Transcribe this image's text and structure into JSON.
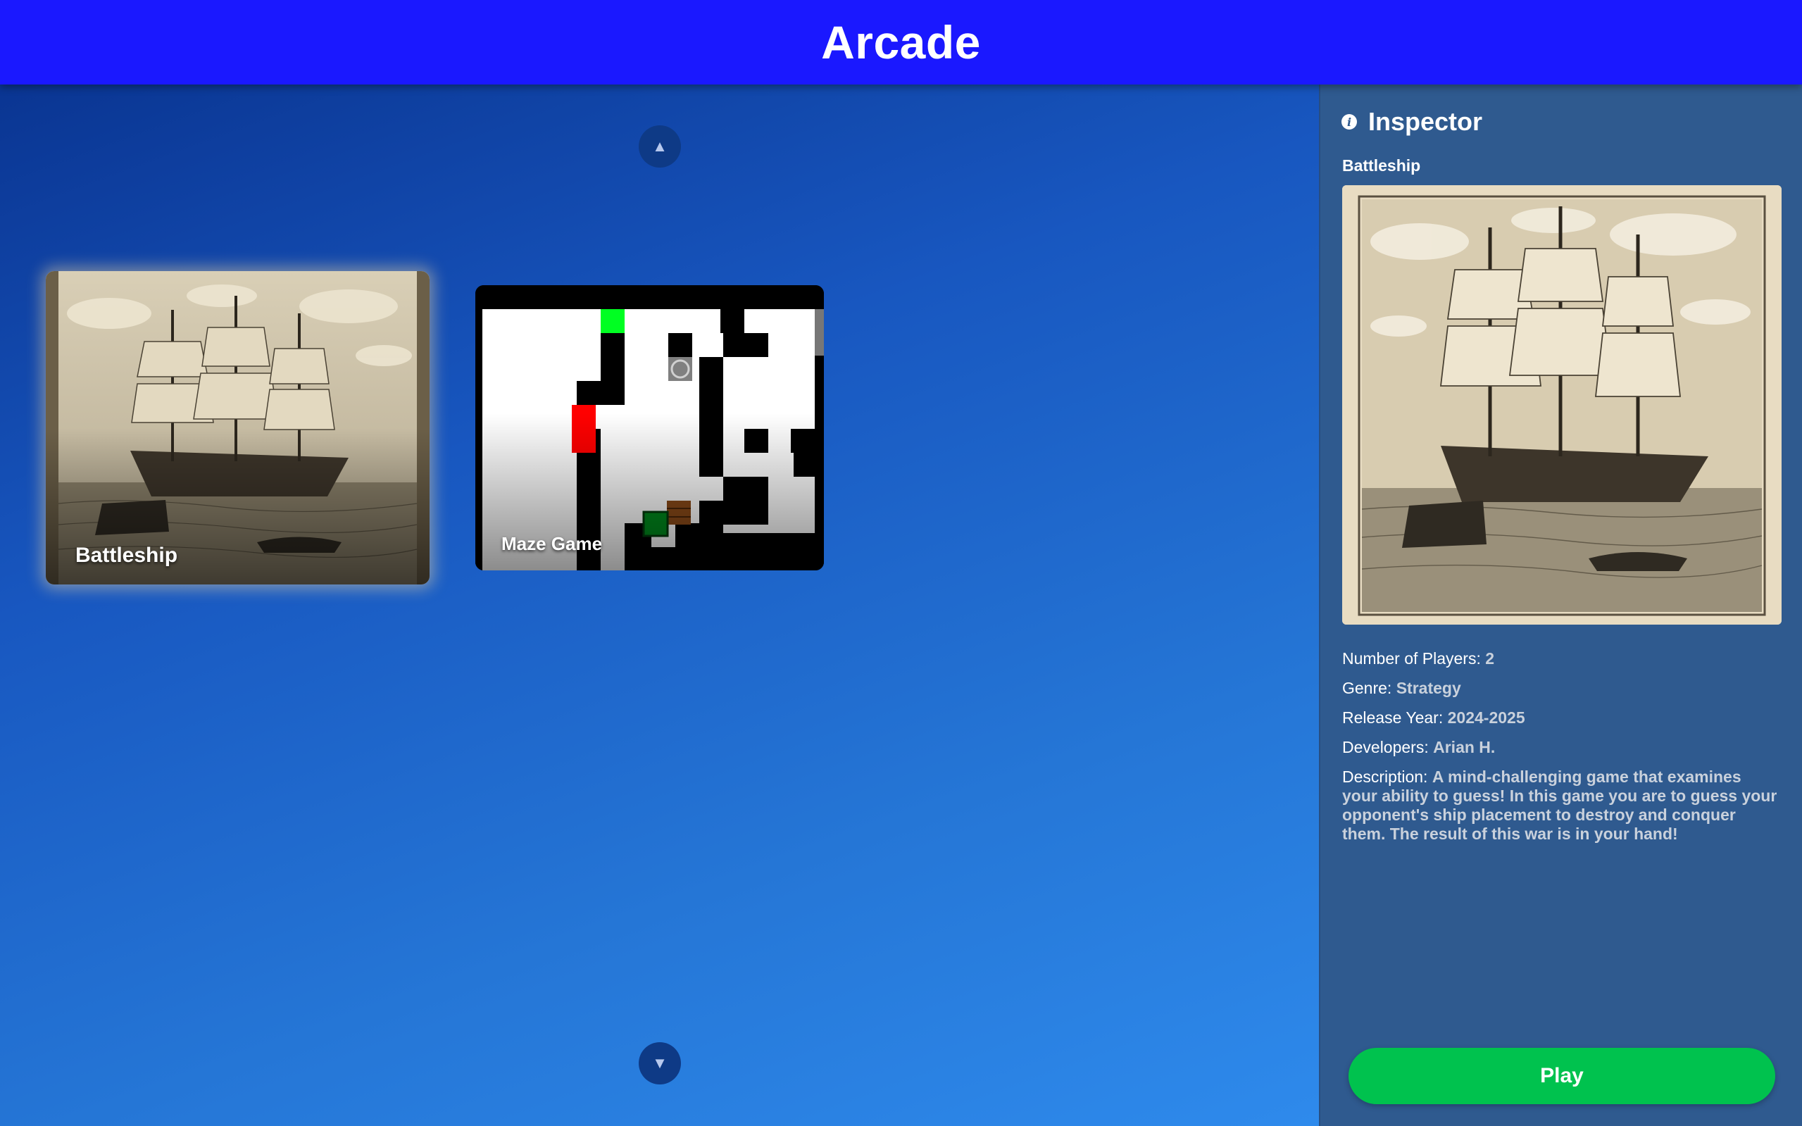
{
  "header": {
    "title": "Arcade"
  },
  "nav": {
    "up_icon": "▲",
    "down_icon": "▼"
  },
  "games": [
    {
      "title": "Battleship",
      "image": "sailing-ship-engraving"
    },
    {
      "title": "Maze Game",
      "image": "maze-grid"
    }
  ],
  "inspector": {
    "title": "Inspector",
    "info_icon": "i",
    "game_title": "Battleship",
    "details": {
      "players_label": "Number of Players: ",
      "players_value": "2",
      "genre_label": "Genre: ",
      "genre_value": "Strategy",
      "year_label": "Release Year: ",
      "year_value": "2024-2025",
      "developers_label": "Developers: ",
      "developers_value": "Arian H.",
      "description_label": "Description: ",
      "description_value": "A mind-challenging game that examines your ability to guess! In this game you are to guess your opponent's ship placement to destroy and conquer them. The result of this war is in your hand!"
    },
    "play_label": "Play"
  },
  "colors": {
    "header": "#1a18ff",
    "inspector_bg": "#2f5a8f",
    "play_button": "#00c24e",
    "maze_start": "#00ff22",
    "maze_enemy": "#ff0000",
    "maze_player": "#008a1c"
  }
}
